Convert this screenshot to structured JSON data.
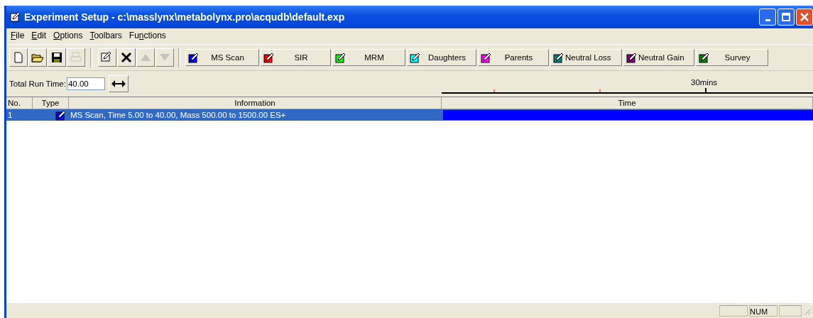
{
  "window": {
    "title": "Experiment Setup - c:\\masslynx\\metabolynx.pro\\acqudb\\default.exp"
  },
  "menu": [
    "File",
    "Edit",
    "Options",
    "Toolbars",
    "Functions"
  ],
  "toolbar": [
    {
      "kind": "new",
      "disabled": false
    },
    {
      "kind": "open",
      "disabled": false
    },
    {
      "kind": "save",
      "disabled": false
    },
    {
      "kind": "print",
      "disabled": true
    },
    {
      "kind": "sep"
    },
    {
      "kind": "edit",
      "disabled": false
    },
    {
      "kind": "delete",
      "disabled": false
    },
    {
      "kind": "up",
      "disabled": true
    },
    {
      "kind": "down",
      "disabled": true
    }
  ],
  "functions": [
    {
      "label": "MS Scan",
      "color": "#0000ff"
    },
    {
      "label": "SIR",
      "color": "#ff0000"
    },
    {
      "label": "MRM",
      "color": "#00ff00"
    },
    {
      "label": "Daughters",
      "color": "#00ffff"
    },
    {
      "label": "Parents",
      "color": "#ff00ff"
    },
    {
      "label": "Neutral Loss",
      "color": "#008080"
    },
    {
      "label": "Neutral Gain",
      "color": "#800080"
    },
    {
      "label": "Survey",
      "color": "#008000"
    }
  ],
  "run_time": {
    "label": "Total Run Time:",
    "value": "40.00"
  },
  "timeline": {
    "label": "30mins"
  },
  "table": {
    "columns": [
      "No.",
      "Type",
      "Information",
      "Time"
    ],
    "rows": [
      {
        "no": "1",
        "color": "#0000ff",
        "information": "MS Scan, Time 5.00 to 40.00, Mass 500.00 to 1500.00 ES+",
        "selected": true
      }
    ]
  },
  "status_bar": {
    "panes": [
      "NUM"
    ]
  }
}
